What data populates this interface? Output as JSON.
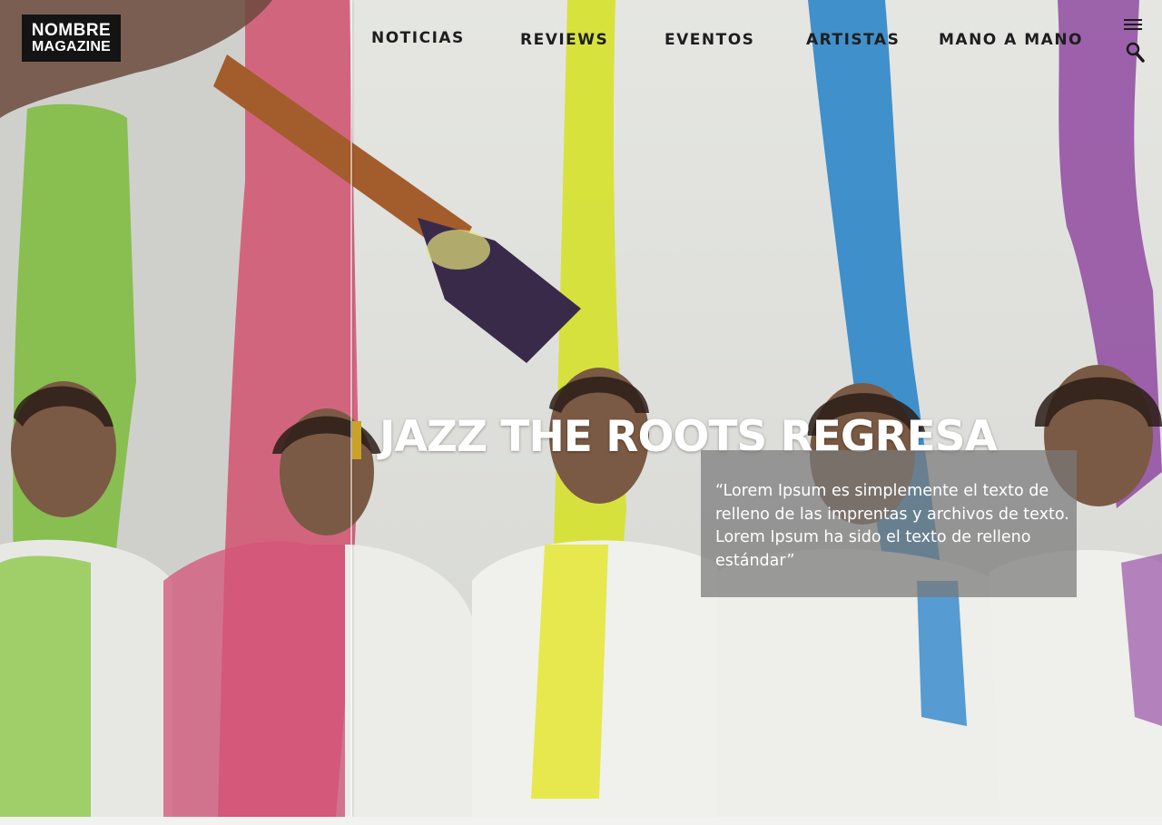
{
  "brand": {
    "line1": "NOMBRE",
    "line2": "MAGAZINE"
  },
  "nav": {
    "items": [
      {
        "label": "NOTICIAS"
      },
      {
        "label": "REVIEWS"
      },
      {
        "label": "EVENTOS"
      },
      {
        "label": "ARTISTAS"
      },
      {
        "label": "MANO A MANO"
      }
    ],
    "menu_icon": "hamburger-menu-icon",
    "search_icon": "search-icon"
  },
  "hero": {
    "image": "band-photo-paint-streaks",
    "headline": "JAZZ THE ROOTS REGRESA",
    "quote": "“Lorem Ipsum es simplemente el texto de relleno de las imprentas y archivos de texto. Lorem Ipsum ha sido el texto de relleno estándar”"
  },
  "colors": {
    "logo_bg": "#141414",
    "nav_text": "#1e1e1e",
    "headline": "#ffffff",
    "accent": "#c9a227",
    "quote_box": "#787878"
  }
}
